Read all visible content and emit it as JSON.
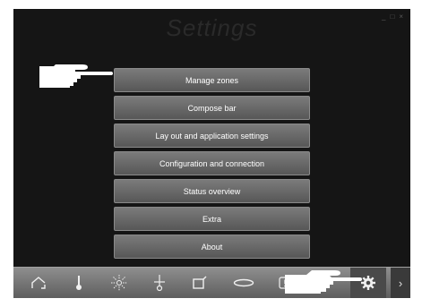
{
  "window": {
    "title": "Settings",
    "controls": {
      "minimize": "_",
      "maximize": "□",
      "close": "×"
    }
  },
  "menu": {
    "items": [
      {
        "label": "Manage zones"
      },
      {
        "label": "Compose bar"
      },
      {
        "label": "Lay out and application settings"
      },
      {
        "label": "Configuration and connection"
      },
      {
        "label": "Status overview"
      },
      {
        "label": "Extra"
      },
      {
        "label": "About"
      }
    ]
  },
  "toolbar": {
    "items": [
      {
        "icon": "home-icon"
      },
      {
        "icon": "thermometer-icon"
      },
      {
        "icon": "sun-icon"
      },
      {
        "icon": "dimmer-icon"
      },
      {
        "icon": "window-icon"
      },
      {
        "icon": "ellipse-icon"
      },
      {
        "icon": "alert-icon"
      },
      {
        "icon": "gear-icon",
        "active": true
      },
      {
        "icon": "chevron-right-icon",
        "label": "›"
      }
    ]
  },
  "colors": {
    "background": "#151515",
    "button": "#6a6a6a",
    "toolbar": "#7a7a7a",
    "title": "#2a2a2a"
  }
}
